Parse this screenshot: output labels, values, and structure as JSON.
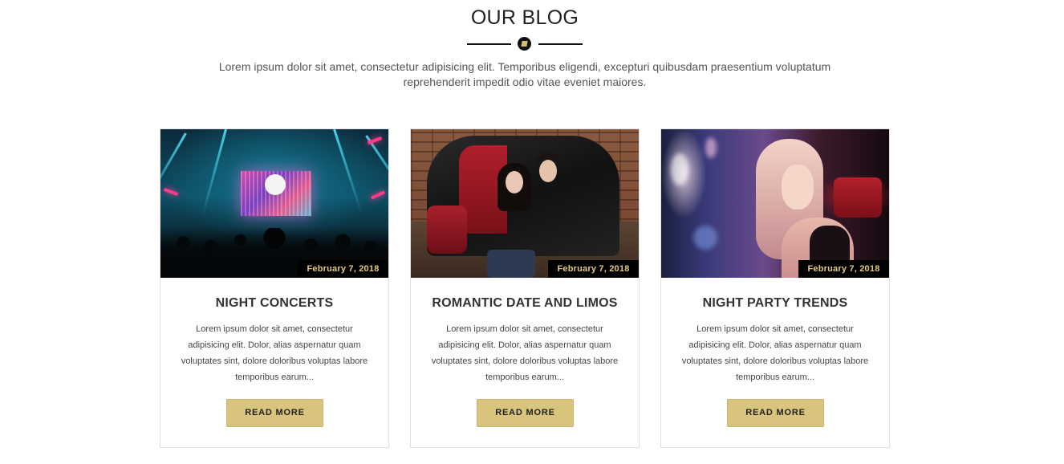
{
  "header": {
    "title": "OUR BLOG",
    "intro_line1": "Lorem ipsum dolor sit amet, consectetur adipisicing elit. Temporibus eligendi, excepturi quibusdam praesentium voluptatum",
    "intro_line2": "reprehenderit impedit odio vitae eveniet maiores."
  },
  "posts": [
    {
      "date": "February 7, 2018",
      "title": "NIGHT CONCERTS",
      "excerpt": "Lorem ipsum dolor sit amet, consectetur adipisicing elit. Dolor, alias aspernatur quam voluptates sint, dolore doloribus voluptas labore temporibus earum...",
      "button": "READ MORE"
    },
    {
      "date": "February 7, 2018",
      "title": "ROMANTIC DATE AND LIMOS",
      "excerpt": "Lorem ipsum dolor sit amet, consectetur adipisicing elit. Dolor, alias aspernatur quam voluptates sint, dolore doloribus voluptas labore temporibus earum...",
      "button": "READ MORE"
    },
    {
      "date": "February 7, 2018",
      "title": "NIGHT PARTY TRENDS",
      "excerpt": "Lorem ipsum dolor sit amet, consectetur adipisicing elit. Dolor, alias aspernatur quam voluptates sint, dolore doloribus voluptas labore temporibus earum...",
      "button": "READ MORE"
    }
  ],
  "colors": {
    "accent": "#d8c47c",
    "date_text": "#e3c97a",
    "date_bg": "#000000"
  }
}
